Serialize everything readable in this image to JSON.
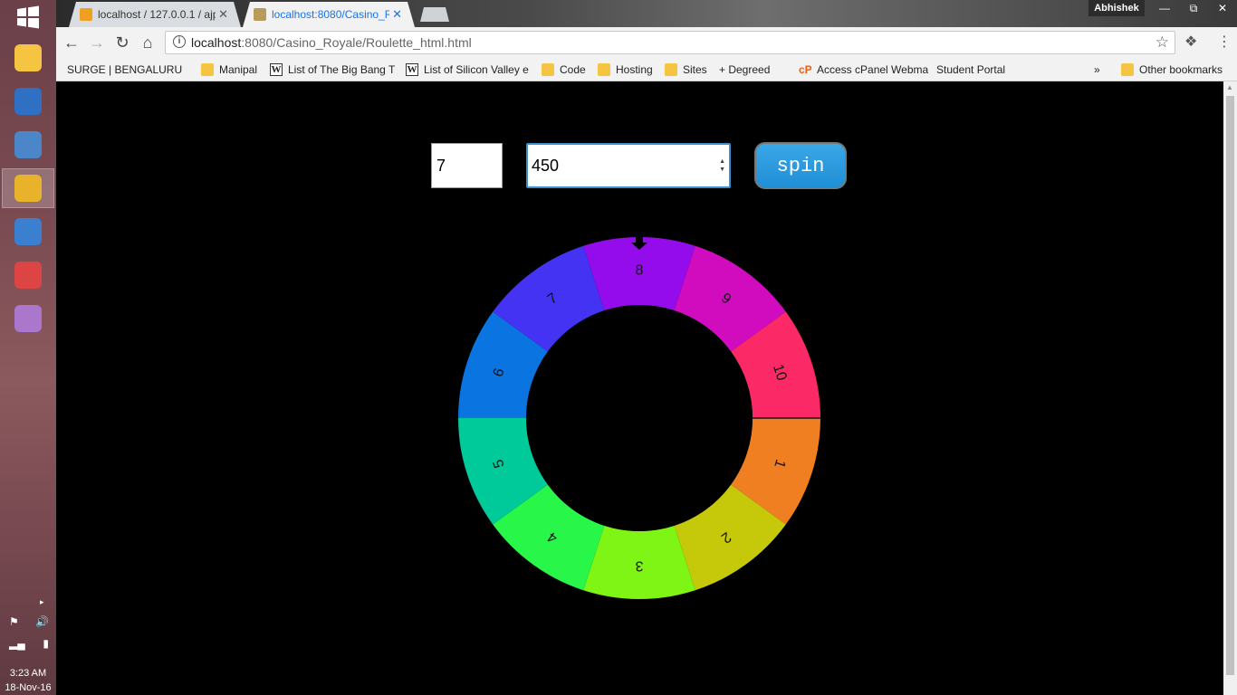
{
  "taskbar": {
    "apps": [
      {
        "name": "file-manager",
        "color": "#f5c542",
        "active": false
      },
      {
        "name": "r-app",
        "color": "#2f6fc4",
        "active": false
      },
      {
        "name": "tableau-app",
        "color": "#4a86c8",
        "active": false
      },
      {
        "name": "chrome-app",
        "color": "#e8b32a",
        "active": true
      },
      {
        "name": "virtualbox-app",
        "color": "#3b7fd0",
        "active": false
      },
      {
        "name": "multi-app",
        "color": "#d44",
        "active": false
      },
      {
        "name": "paint-app",
        "color": "#a7c",
        "active": false
      }
    ],
    "time": "3:23 AM",
    "date": "18-Nov-16"
  },
  "browser": {
    "tabs": [
      {
        "title": "localhost / 127.0.0.1 / ajp",
        "active": false
      },
      {
        "title": "localhost:8080/Casino_Ro",
        "active": true
      }
    ],
    "user": "Abhishek",
    "window_controls": {
      "minimize": "—",
      "restore": "⧉",
      "close": "✕"
    },
    "url": {
      "host": "localhost",
      "path": ":8080/Casino_Royale/Roulette_html.html"
    },
    "bookmarks": [
      {
        "label": "SURGE | BENGALURU",
        "icon": "page"
      },
      {
        "label": "Manipal",
        "icon": "folder"
      },
      {
        "label": "List of The Big Bang T",
        "icon": "wiki"
      },
      {
        "label": "List of Silicon Valley e",
        "icon": "wiki"
      },
      {
        "label": "Code",
        "icon": "folder"
      },
      {
        "label": "Hosting",
        "icon": "folder"
      },
      {
        "label": "Sites",
        "icon": "folder"
      },
      {
        "label": "+ Degreed",
        "icon": "page"
      },
      {
        "label": "Access cPanel Webma",
        "icon": "cp"
      },
      {
        "label": "Student Portal",
        "icon": "page"
      }
    ],
    "bookmarks_overflow": "»",
    "other_bookmarks": "Other bookmarks"
  },
  "roulette": {
    "segments_input": "7",
    "speed_input": "450",
    "spin_label": "spin",
    "pointer_color": "#000000",
    "segments": [
      {
        "label": "1",
        "color": "#f07f22"
      },
      {
        "label": "2",
        "color": "#c6c80a"
      },
      {
        "label": "3",
        "color": "#7ef514"
      },
      {
        "label": "4",
        "color": "#28f74a"
      },
      {
        "label": "5",
        "color": "#00c99a"
      },
      {
        "label": "6",
        "color": "#0a74e0"
      },
      {
        "label": "7",
        "color": "#4433f2"
      },
      {
        "label": "8",
        "color": "#940ceb"
      },
      {
        "label": "9",
        "color": "#d10cbf"
      },
      {
        "label": "10",
        "color": "#fb2a66"
      }
    ]
  }
}
